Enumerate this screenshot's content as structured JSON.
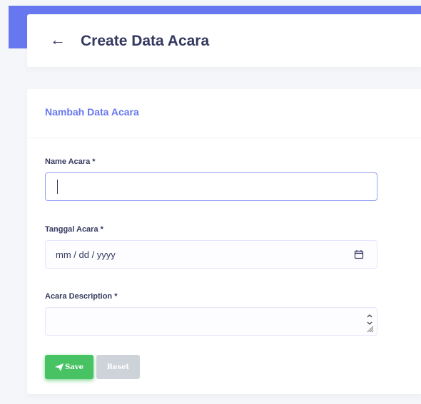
{
  "header": {
    "back_icon": "arrow-left-icon",
    "title": "Create Data Acara"
  },
  "card": {
    "title": "Nambah Data Acara"
  },
  "form": {
    "name_label": "Name Acara *",
    "name_value": "",
    "date_label": "Tanggal Acara *",
    "date_placeholder": "mm / dd / yyyy",
    "date_icon": "calendar-icon",
    "description_label": "Acara Description *",
    "description_value": ""
  },
  "buttons": {
    "save_label": "Save",
    "save_icon": "paper-plane-icon",
    "reset_label": "Reset"
  },
  "colors": {
    "primary": "#6777ef",
    "success": "#47c363",
    "muted": "#cdd3d8",
    "text": "#34395e"
  }
}
